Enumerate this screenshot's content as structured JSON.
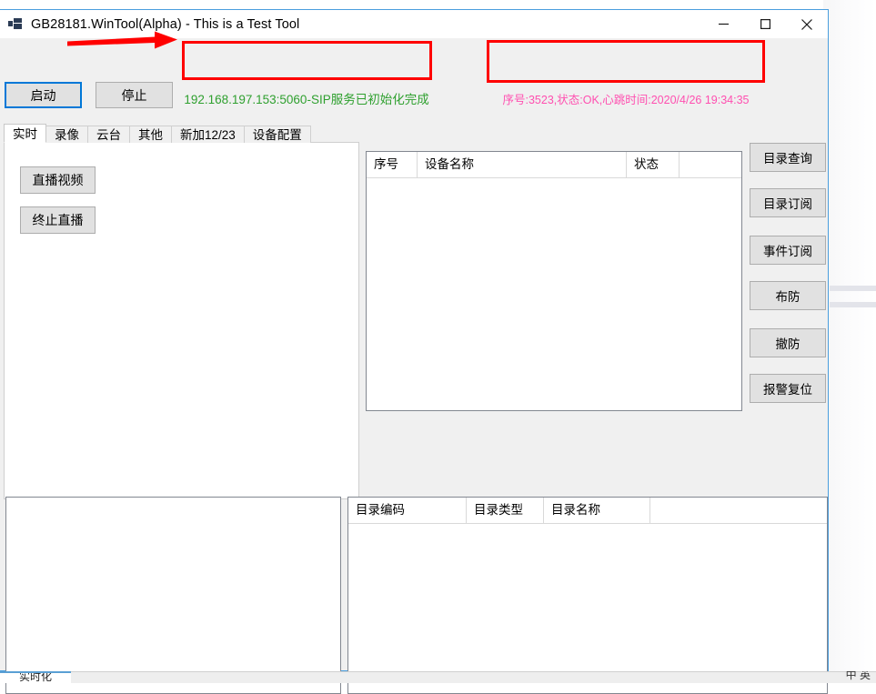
{
  "window": {
    "title": "GB28181.WinTool(Alpha) - This is a Test Tool",
    "icon": "app-icon",
    "controls": {
      "minimize": "─",
      "maximize": "□",
      "close": "✕"
    }
  },
  "toolbar": {
    "start_label": "启动",
    "stop_label": "停止",
    "status_left": "192.168.197.153:5060-SIP服务已初始化完成",
    "status_right": "序号:3523,状态:OK,心跳时间:2020/4/26 19:34:35",
    "status_left_color": "#2fa02f",
    "status_right_color": "#ff4fb0"
  },
  "tabs": [
    {
      "label": "实时",
      "active": true
    },
    {
      "label": "录像",
      "active": false
    },
    {
      "label": "云台",
      "active": false
    },
    {
      "label": "其他",
      "active": false
    },
    {
      "label": "新加12/23",
      "active": false
    },
    {
      "label": "设备配置",
      "active": false
    }
  ],
  "tab_page": {
    "live_video_label": "直播视频",
    "stop_live_label": "终止直播"
  },
  "device_grid": {
    "columns": [
      "序号",
      "设备名称",
      "状态",
      ""
    ],
    "rows": []
  },
  "command_buttons": [
    {
      "label": "目录查询"
    },
    {
      "label": "目录订阅"
    },
    {
      "label": "事件订阅"
    },
    {
      "label": "布防"
    },
    {
      "label": "撤防"
    },
    {
      "label": "报警复位"
    }
  ],
  "log_pane": {
    "text": ""
  },
  "catalog_grid": {
    "columns": [
      "目录编码",
      "目录类型",
      "目录名称",
      ""
    ],
    "rows": []
  },
  "annotations": {
    "color": "#ff0000",
    "arrow": "arrow-right",
    "box_left_target": "status_left",
    "box_right_target": "status_right"
  },
  "taskbar": {
    "left_label": "实时化",
    "right_label": "中 英"
  }
}
